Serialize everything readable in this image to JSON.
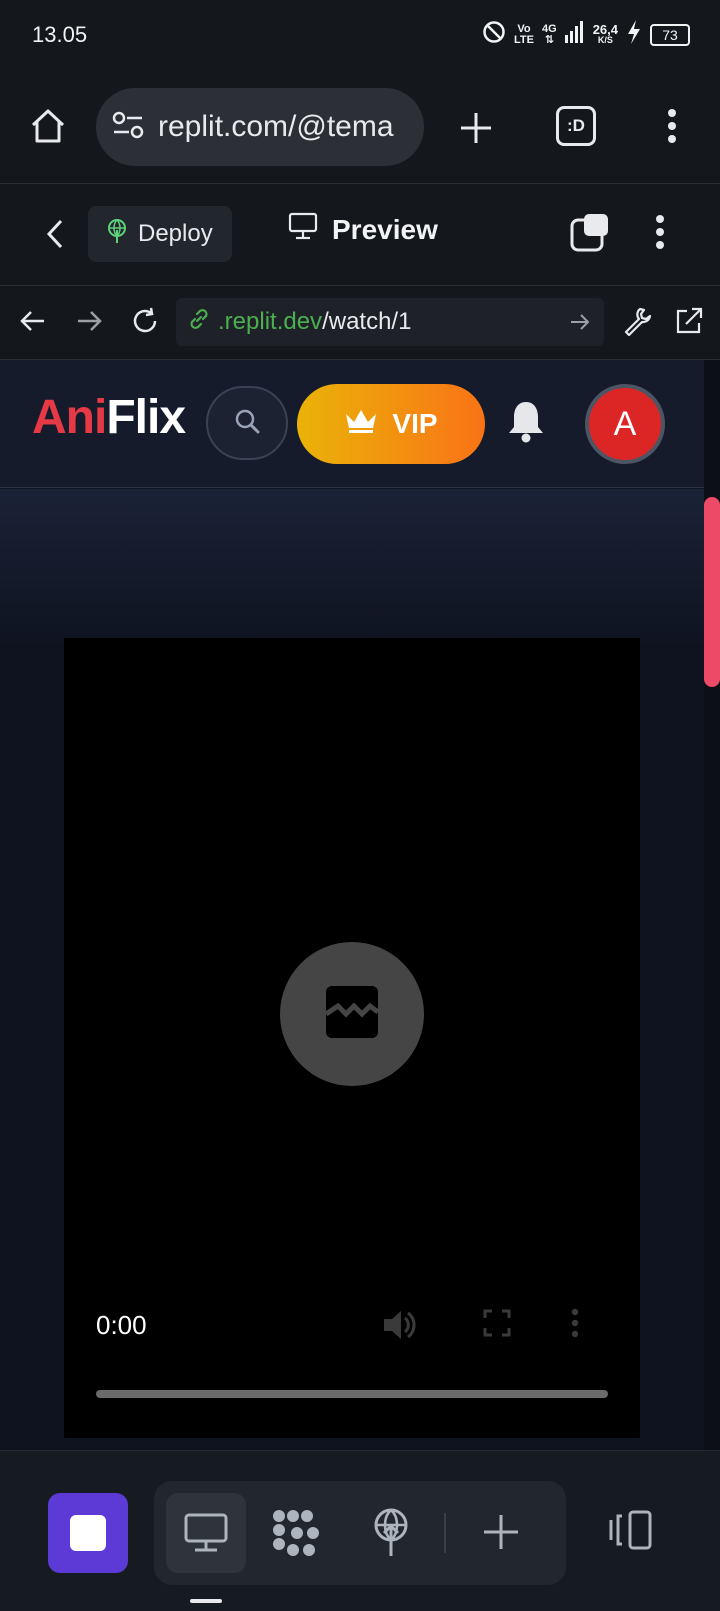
{
  "status_bar": {
    "time": "13.05",
    "network_vo": "Vo",
    "network_lte": "LTE",
    "network_4g": "4G",
    "network_arrows": "⇅",
    "speed_value": "26,4",
    "speed_unit": "K/S",
    "battery": "73"
  },
  "browser": {
    "url": "replit.com/@tema"
  },
  "replit_toolbar": {
    "deploy_label": "Deploy",
    "preview_label": "Preview"
  },
  "webview": {
    "url_domain": ".replit.dev",
    "url_path": "/watch/1"
  },
  "site": {
    "logo_part1": "Ani",
    "logo_part2": "Flix",
    "vip_label": "VIP",
    "avatar_letter": "A"
  },
  "video": {
    "current_time": "0:00",
    "progress": 0
  },
  "colors": {
    "brand_red": "#e53946",
    "vip_gradient_start": "#eab308",
    "vip_gradient_end": "#f97316",
    "replit_stop": "#5b3ad6",
    "scrollbar": "#ec4a66",
    "link_green": "#4caf50"
  },
  "icons": {
    "status": [
      "do-not-disturb-icon",
      "signal-icon",
      "charging-icon",
      "battery-icon"
    ],
    "browser": [
      "home-icon",
      "site-settings-icon",
      "new-tab-icon",
      "tab-switcher-icon",
      "menu-icon"
    ],
    "replit": [
      "back-icon",
      "deploy-icon",
      "preview-monitor-icon",
      "copy-windows-icon",
      "more-icon"
    ],
    "webview": [
      "arrow-back-icon",
      "arrow-forward-icon",
      "reload-icon",
      "link-icon",
      "go-icon",
      "wrench-icon",
      "open-external-icon"
    ],
    "site": [
      "search-icon",
      "crown-icon",
      "bell-icon"
    ],
    "video": [
      "broken-media-icon",
      "volume-icon",
      "fullscreen-icon",
      "more-vertical-icon"
    ],
    "bottom": [
      "stop-icon",
      "monitor-icon",
      "agent-dots-icon",
      "deploy-globe-icon",
      "plus-icon",
      "panels-icon"
    ]
  }
}
